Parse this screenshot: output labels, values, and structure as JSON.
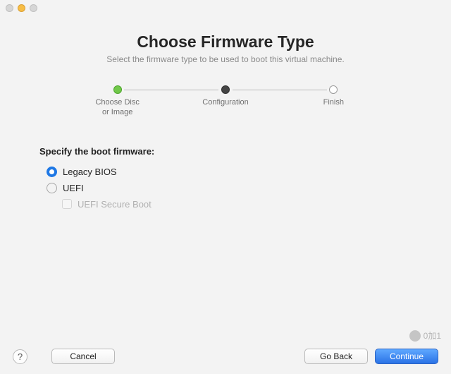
{
  "header": {
    "title": "Choose Firmware Type",
    "subtitle": "Select the firmware type to be used to boot this virtual machine."
  },
  "stepper": {
    "steps": [
      {
        "label": "Choose Disc\nor Image",
        "state": "done"
      },
      {
        "label": "Configuration",
        "state": "active"
      },
      {
        "label": "Finish",
        "state": "pending"
      }
    ]
  },
  "form": {
    "section_label": "Specify the boot firmware:",
    "options": {
      "legacy_bios": {
        "label": "Legacy BIOS",
        "selected": true
      },
      "uefi": {
        "label": "UEFI",
        "selected": false
      },
      "uefi_secure_boot": {
        "label": "UEFI Secure Boot",
        "checked": false,
        "enabled": false
      }
    }
  },
  "footer": {
    "help": "?",
    "cancel": "Cancel",
    "go_back": "Go Back",
    "continue": "Continue"
  },
  "watermark": "0加1"
}
